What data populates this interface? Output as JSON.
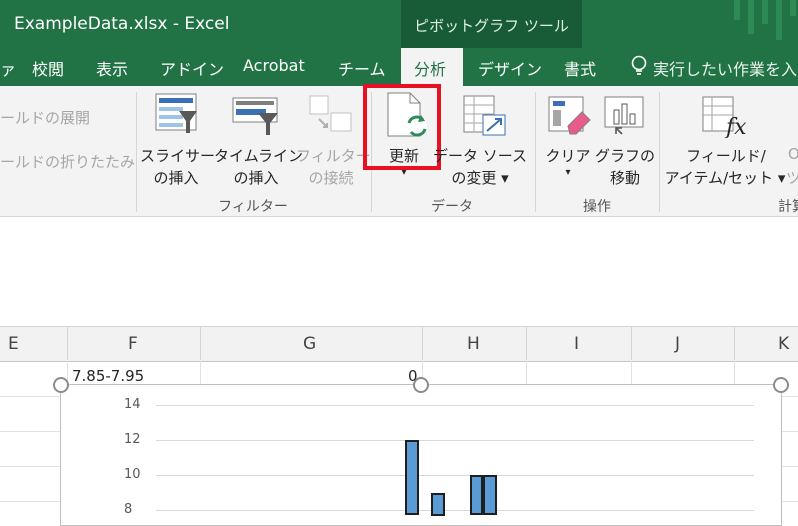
{
  "window": {
    "title": "ExampleData.xlsx - Excel",
    "context_title": "ピボットグラフ ツール"
  },
  "tabs": {
    "partial": "ァ",
    "review": "校閲",
    "view": "表示",
    "addins": "アドイン",
    "acrobat": "Acrobat",
    "team": "チーム",
    "analyze": "分析",
    "design": "デザイン",
    "format": "書式",
    "tellme": "実行したい作業を入"
  },
  "ribbon": {
    "expand_field": "ールドの展開",
    "collapse_field": "ールドの折りたたみ",
    "slicer": {
      "line1": "スライサー",
      "line2": "の挿入"
    },
    "timeline": {
      "line1": "タイムライン",
      "line2": "の挿入"
    },
    "filter_conn": {
      "line1": "フィルター",
      "line2": "の接続"
    },
    "refresh": {
      "line1": "更新",
      "line2": "▾"
    },
    "change_source": {
      "line1": "データ ソース",
      "line2": "の変更 ▾"
    },
    "clear": {
      "line1": "クリア",
      "line2": "▾"
    },
    "move_chart": {
      "line1": "グラフの",
      "line2": "移動"
    },
    "fields": {
      "line1": "フィールド/",
      "line2": "アイテム/セット ▾"
    },
    "partial_right": {
      "line1": "O",
      "line2": "ツ"
    },
    "groups": {
      "filter": "フィルター",
      "data": "データ",
      "actions": "操作",
      "calc": "計算"
    }
  },
  "columns": [
    "E",
    "F",
    "G",
    "H",
    "I",
    "J",
    "K"
  ],
  "cells": {
    "f1": "7.85-7.95",
    "g1": "0"
  },
  "chart_data": {
    "type": "bar",
    "y_ticks": [
      "14",
      "12",
      "10",
      "8"
    ],
    "ylim": [
      8,
      14
    ],
    "values": [
      12,
      9,
      10,
      10
    ],
    "colors": {
      "bar": "#5b9bd5"
    }
  },
  "colors": {
    "excel_green": "#217346",
    "highlight": "#e81123"
  }
}
